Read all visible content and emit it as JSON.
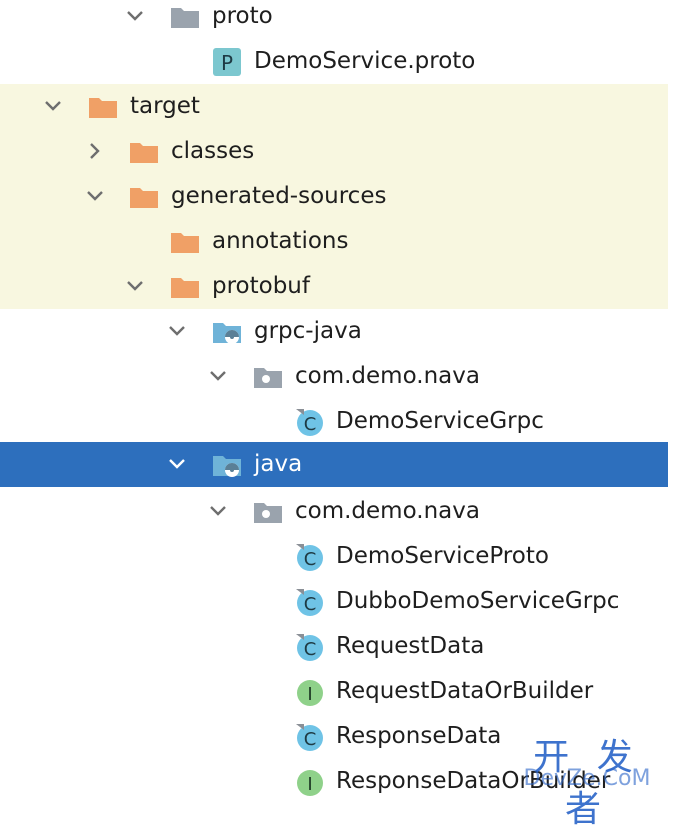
{
  "tree": {
    "rows": [
      {
        "label": "proto",
        "icon": "folder-gray-icon",
        "expanded": true,
        "state": "normal"
      },
      {
        "label": "DemoService.proto",
        "icon": "proto-file-icon",
        "expanded": null,
        "state": "normal"
      },
      {
        "label": "target",
        "icon": "folder-orange-icon",
        "expanded": true,
        "state": "excluded"
      },
      {
        "label": "classes",
        "icon": "folder-orange-icon",
        "expanded": false,
        "state": "excluded"
      },
      {
        "label": "generated-sources",
        "icon": "folder-orange-icon",
        "expanded": true,
        "state": "excluded"
      },
      {
        "label": "annotations",
        "icon": "folder-orange-icon",
        "expanded": null,
        "state": "excluded"
      },
      {
        "label": "protobuf",
        "icon": "folder-orange-icon",
        "expanded": true,
        "state": "excluded"
      },
      {
        "label": "grpc-java",
        "icon": "source-root-folder-icon",
        "expanded": true,
        "state": "normal"
      },
      {
        "label": "com.demo.nava",
        "icon": "package-icon",
        "expanded": true,
        "state": "normal"
      },
      {
        "label": "DemoServiceGrpc",
        "icon": "java-class-icon",
        "expanded": null,
        "state": "normal"
      },
      {
        "label": "java",
        "icon": "source-root-folder-icon",
        "expanded": true,
        "state": "selected"
      },
      {
        "label": "com.demo.nava",
        "icon": "package-icon",
        "expanded": true,
        "state": "normal"
      },
      {
        "label": "DemoServiceProto",
        "icon": "java-class-icon",
        "expanded": null,
        "state": "normal"
      },
      {
        "label": "DubboDemoServiceGrpc",
        "icon": "java-class-icon",
        "expanded": null,
        "state": "normal"
      },
      {
        "label": "RequestData",
        "icon": "java-class-icon",
        "expanded": null,
        "state": "normal"
      },
      {
        "label": "RequestDataOrBuilder",
        "icon": "java-interface-icon",
        "expanded": null,
        "state": "normal"
      },
      {
        "label": "ResponseData",
        "icon": "java-class-icon",
        "expanded": null,
        "state": "normal"
      },
      {
        "label": "ResponseDataOrBuilder",
        "icon": "java-interface-icon",
        "expanded": null,
        "state": "normal"
      }
    ]
  },
  "colors": {
    "excluded_bg": "#f8f7e0",
    "selected_bg": "#2d6fbd",
    "folder_orange": "#f0a066",
    "folder_gray": "#9aa3ad",
    "class_blue": "#6fc3e6",
    "interface_green": "#8fd18a",
    "proto_teal": "#7cc7cf"
  },
  "watermark": {
    "title": "开 发 者",
    "subtitle": "DevZe.CoM"
  }
}
